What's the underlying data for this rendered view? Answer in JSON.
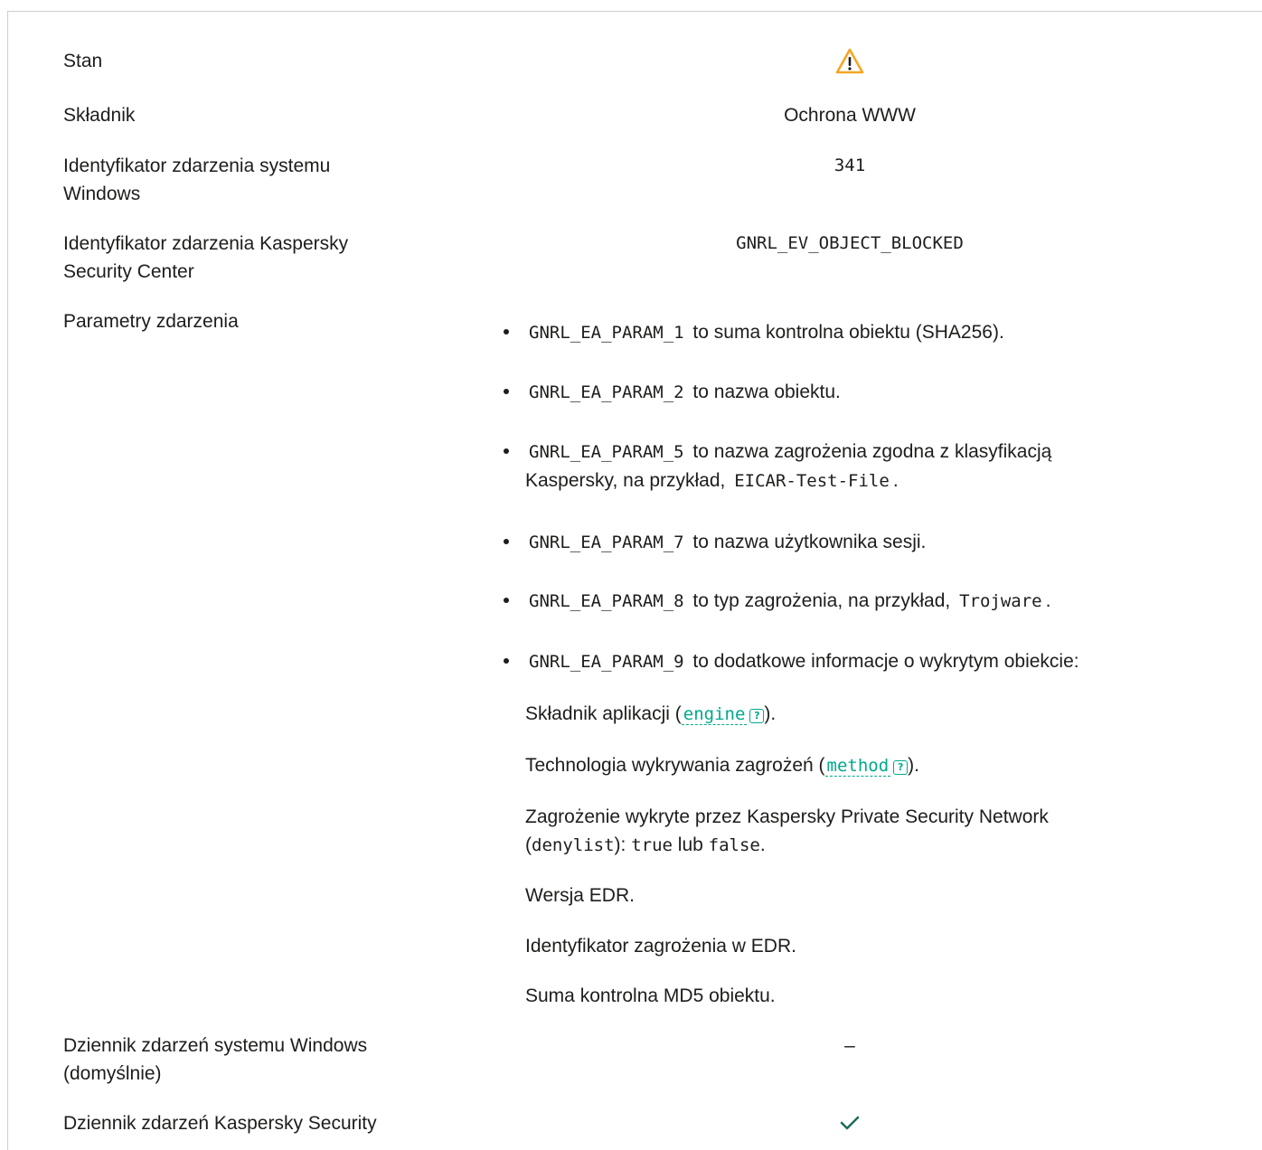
{
  "rows": {
    "status": {
      "label": "Stan",
      "icon": "warning-triangle-icon",
      "icon_color": "#f5a623"
    },
    "component": {
      "label": "Składnik",
      "value": "Ochrona WWW"
    },
    "windows_event_id": {
      "label_line1": "Identyfikator zdarzenia systemu",
      "label_line2": "Windows",
      "value": "341"
    },
    "ksc_event_id": {
      "label_line1": "Identyfikator zdarzenia Kaspersky",
      "label_line2": "Security Center",
      "value": "GNRL_EV_OBJECT_BLOCKED"
    },
    "event_params": {
      "label": "Parametry zdarzenia",
      "items": [
        {
          "code": "GNRL_EA_PARAM_1",
          "text": " to suma kontrolna obiektu (SHA256)."
        },
        {
          "code": "GNRL_EA_PARAM_2",
          "text": " to nazwa obiektu."
        },
        {
          "code": "GNRL_EA_PARAM_5",
          "text": " to nazwa zagrożenia zgodna z klasyfikacją",
          "line2_text": "Kaspersky, na przykład, ",
          "line2_code": "EICAR-Test-File",
          "line2_end": "."
        },
        {
          "code": "GNRL_EA_PARAM_7",
          "text": " to nazwa użytkownika sesji."
        },
        {
          "code": "GNRL_EA_PARAM_8",
          "text": " to typ zagrożenia, na przykład, ",
          "code2": "Trojware",
          "end": "."
        },
        {
          "code": "GNRL_EA_PARAM_9",
          "text": " to dodatkowe informacje o wykrytym obiekcie:"
        }
      ],
      "details": {
        "engine_prefix": "Składnik aplikacji (",
        "engine_link": "engine",
        "engine_suffix": ").",
        "method_prefix": "Technologia wykrywania zagrożeń (",
        "method_link": "method",
        "method_suffix": ").",
        "ksn_line1": "Zagrożenie wykryte przez Kaspersky Private Security Network",
        "ksn_open": "(",
        "ksn_code": "denylist",
        "ksn_mid": "): ",
        "ksn_true": "true",
        "ksn_or": " lub ",
        "ksn_false": "false",
        "ksn_end": ".",
        "edr_version": "Wersja EDR.",
        "edr_threat_id": "Identyfikator zagrożenia w EDR.",
        "md5": "Suma kontrolna MD5 obiektu."
      }
    },
    "windows_log": {
      "label_line1": "Dziennik zdarzeń systemu Windows",
      "label_line2": "(domyślnie)",
      "value": "–"
    },
    "ksc_log": {
      "label_line1": "Dziennik zdarzeń Kaspersky Security",
      "icon": "checkmark-icon",
      "icon_color": "#1e6e5a"
    }
  }
}
